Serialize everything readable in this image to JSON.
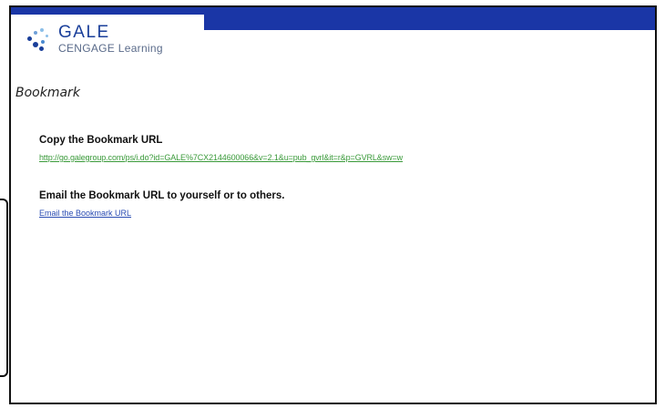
{
  "brand": {
    "name": "GALE",
    "tagline": "CENGAGE Learning",
    "primary_color": "#1a36a6",
    "logo_icon": "gale-dots-logo-icon"
  },
  "page": {
    "title": "Bookmark"
  },
  "copy_section": {
    "heading": "Copy the Bookmark URL",
    "url": "http://go.galegroup.com/ps/i.do?id=GALE%7CX2144600066&v=2.1&u=pub_gvrl&it=r&p=GVRL&sw=w",
    "link_color": "#3a9a3a"
  },
  "email_section": {
    "heading": "Email the Bookmark URL to yourself or to others.",
    "link_label": "Email the Bookmark URL",
    "link_color": "#2a4cb3"
  }
}
